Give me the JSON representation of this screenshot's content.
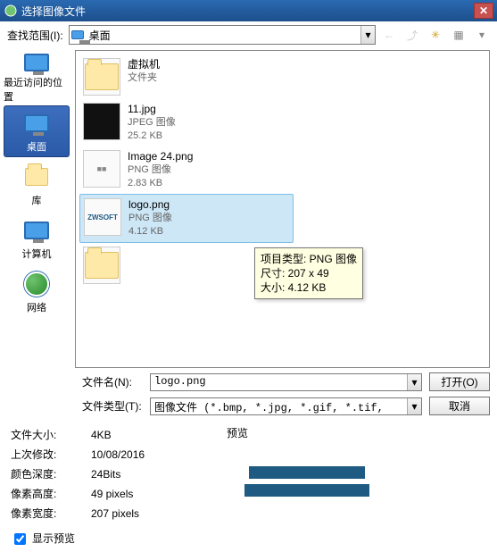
{
  "window": {
    "title": "选择图像文件"
  },
  "lookin": {
    "label": "查找范围(I):",
    "value": "桌面"
  },
  "toolbar_icons": {
    "back": "←",
    "up": "⤴",
    "new": "✳",
    "views": "▦"
  },
  "sidebar": {
    "items": [
      {
        "label": "最近访问的位置"
      },
      {
        "label": "桌面"
      },
      {
        "label": "库"
      },
      {
        "label": "计算机"
      },
      {
        "label": "网络"
      }
    ]
  },
  "files": [
    {
      "name": "虚拟机",
      "type": "文件夹",
      "size": ""
    },
    {
      "name": "11.jpg",
      "type": "JPEG 图像",
      "size": "25.2 KB"
    },
    {
      "name": "Image 24.png",
      "type": "PNG 图像",
      "size": "2.83 KB"
    },
    {
      "name": "logo.png",
      "type": "PNG 图像",
      "size": "4.12 KB"
    },
    {
      "name": "",
      "type": "",
      "size": ""
    }
  ],
  "tooltip": {
    "l1": "项目类型: PNG 图像",
    "l2": "尺寸: 207 x 49",
    "l3": "大小: 4.12 KB"
  },
  "form": {
    "name_label": "文件名(N):",
    "name_value": "logo.png",
    "type_label": "文件类型(T):",
    "type_value": "图像文件 (*.bmp, *.jpg, *.gif, *.tif,",
    "open": "打开(O)",
    "cancel": "取消"
  },
  "props": {
    "size_k": "文件大小:",
    "size_v": "4KB",
    "date_k": "上次修改:",
    "date_v": "10/08/2016",
    "depth_k": "颜色深度:",
    "depth_v": "24Bits",
    "h_k": "像素高度:",
    "h_v": "49 pixels",
    "w_k": "像素宽度:",
    "w_v": "207 pixels",
    "chk": "显示预览"
  },
  "preview": {
    "title": "预览"
  }
}
